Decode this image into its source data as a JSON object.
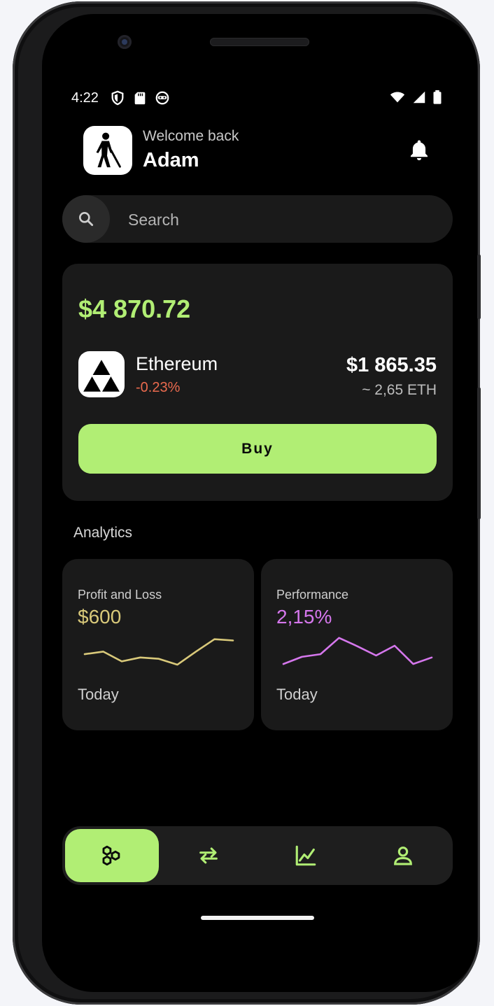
{
  "status_bar": {
    "time": "4:22"
  },
  "header": {
    "welcome": "Welcome back",
    "name": "Adam"
  },
  "search": {
    "placeholder": "Search"
  },
  "portfolio": {
    "balance": "$4 870.72",
    "coin": {
      "name": "Ethereum",
      "change": "-0.23%",
      "price": "$1 865.35",
      "amount": "~ 2,65 ETH"
    },
    "buy_label": "Buy"
  },
  "analytics": {
    "title": "Analytics",
    "cards": [
      {
        "label": "Profit and Loss",
        "value": "$600",
        "period": "Today",
        "color": "#d9c97a",
        "trend": [
          32,
          36,
          21,
          27,
          25,
          16,
          36,
          55,
          53
        ]
      },
      {
        "label": "Performance",
        "value": "2,15%",
        "period": "Today",
        "color": "#d577ec",
        "trend": [
          17,
          28,
          32,
          57,
          44,
          30,
          45,
          17,
          27
        ]
      }
    ]
  },
  "nav": {
    "items": [
      {
        "icon": "hexagons-icon",
        "active": true
      },
      {
        "icon": "swap-arrows-icon",
        "active": false
      },
      {
        "icon": "line-chart-icon",
        "active": false
      },
      {
        "icon": "profile-icon",
        "active": false
      }
    ]
  },
  "colors": {
    "accent": "#b1ee74",
    "negative": "#ea6a4e",
    "card": "#1a1a1a",
    "background": "#000000"
  }
}
